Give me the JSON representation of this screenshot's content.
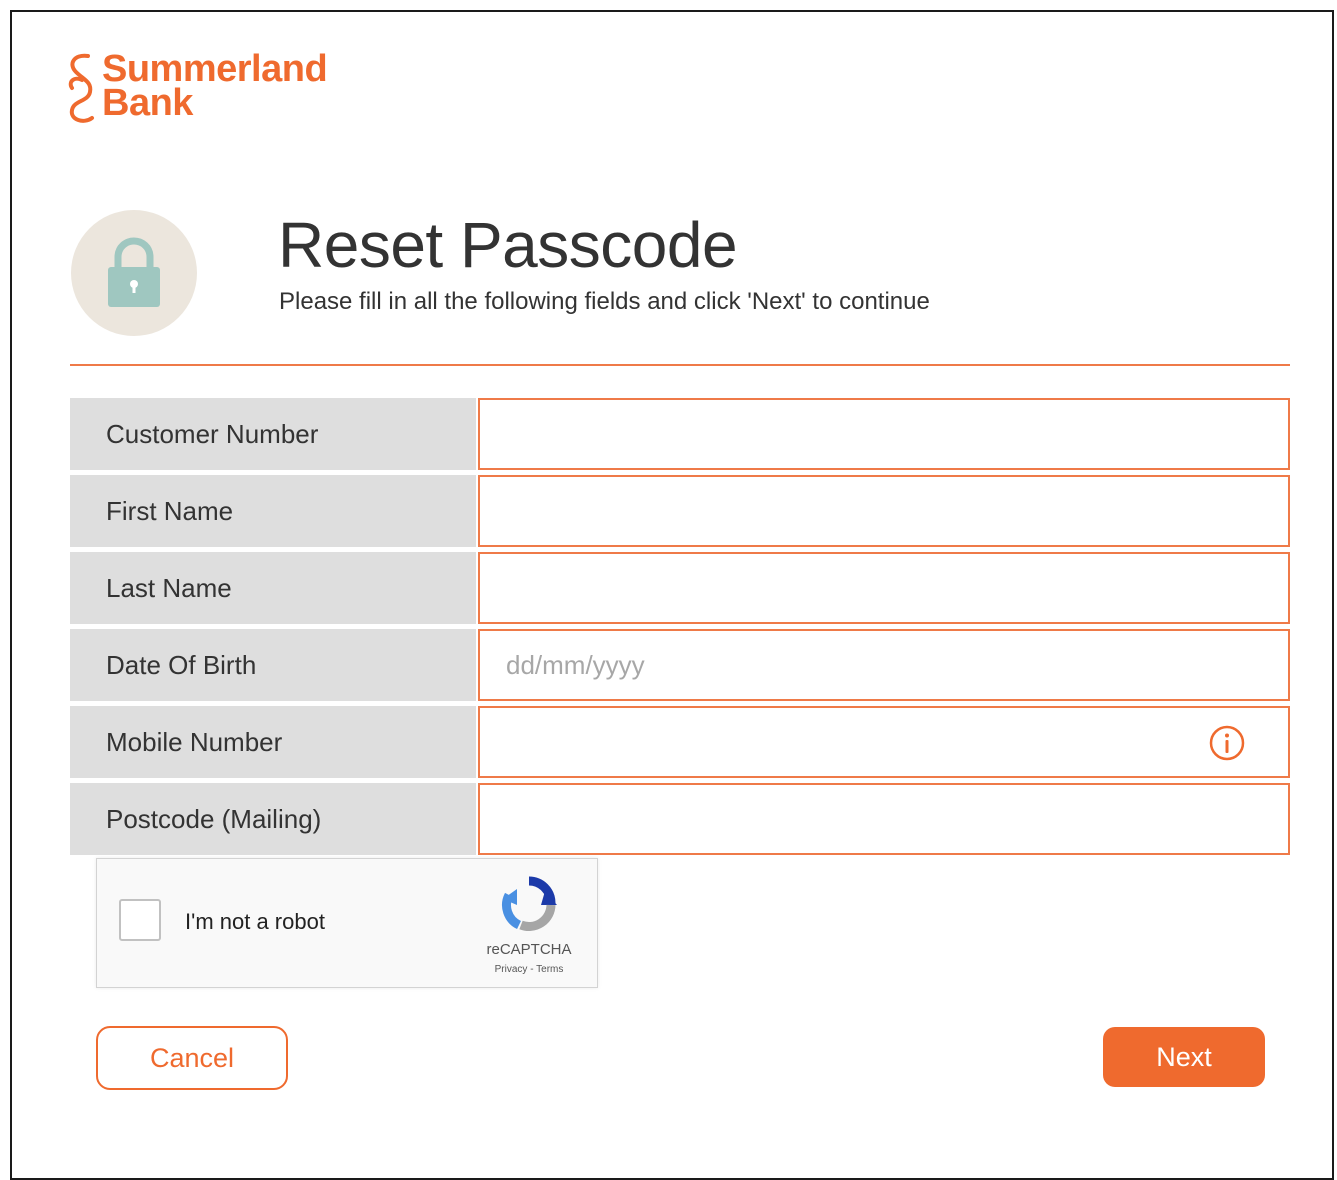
{
  "brand": {
    "name_line1": "Summerland",
    "name_line2": "Bank",
    "color": "#ef6a2e",
    "icon": "s-swirl-logo-icon"
  },
  "header": {
    "icon": "padlock-icon",
    "title": "Reset Passcode",
    "subtitle": "Please fill in all the following fields and click 'Next' to continue"
  },
  "form": {
    "fields": [
      {
        "label": "Customer Number",
        "value": "",
        "placeholder": ""
      },
      {
        "label": "First Name",
        "value": "",
        "placeholder": ""
      },
      {
        "label": "Last Name",
        "value": "",
        "placeholder": ""
      },
      {
        "label": "Date Of Birth",
        "value": "",
        "placeholder": "dd/mm/yyyy"
      },
      {
        "label": "Mobile Number",
        "value": "",
        "placeholder": "",
        "icon": "info-icon"
      },
      {
        "label": "Postcode (Mailing)",
        "value": "",
        "placeholder": ""
      }
    ]
  },
  "captcha": {
    "label": "I'm not a robot",
    "brand": "reCAPTCHA",
    "links": "Privacy - Terms",
    "checked": false
  },
  "actions": {
    "cancel_label": "Cancel",
    "next_label": "Next"
  },
  "colors": {
    "accent": "#ef6a2e",
    "field_border": "#ef7a48",
    "label_bg": "#dedede",
    "lock_circle_bg": "#ece6dd",
    "lock_color": "#9fc7c0"
  }
}
